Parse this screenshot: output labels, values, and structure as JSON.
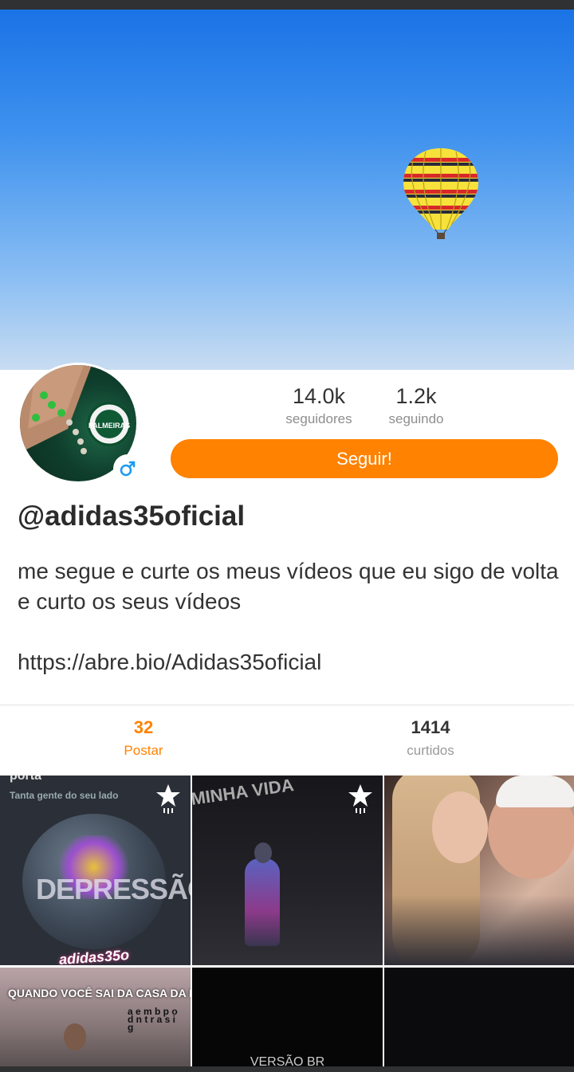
{
  "profile": {
    "username": "@adidas35oficial",
    "gender_icon": "male-icon",
    "avatar_text": "PALMEIRAS"
  },
  "stats": {
    "followers_value": "14.0k",
    "followers_label": "seguidores",
    "following_value": "1.2k",
    "following_label": "seguindo"
  },
  "follow_button": {
    "label": "Seguir!"
  },
  "bio": {
    "line1": "me segue e curte os meus vídeos que eu sigo de volta e curto os seus vídeos",
    "link": "https://abre.bio/Adidas35oficial"
  },
  "tabs": [
    {
      "count": "32",
      "label": "Postar",
      "active": true
    },
    {
      "count": "1414",
      "label": "curtidos",
      "active": false
    }
  ],
  "posts": [
    {
      "overlay_top": "porta",
      "overlay_sub": "Tanta gente do seu lado",
      "overlay_big": "DEPRESSÃO",
      "overlay_bottom": "adidas35o",
      "starred": true
    },
    {
      "overlay_top": "MINHA VIDA",
      "starred": true
    },
    {
      "starred": false
    },
    {
      "overlay_top": "QUANDO VOCÊ SAI DA CASA DA MÃE",
      "starred": false
    },
    {
      "overlay_bottom": "VERSÃO BR",
      "starred": false
    },
    {
      "starred": false
    }
  ],
  "colors": {
    "accent": "#ff8200",
    "text_dark": "#2b2b2b",
    "text_muted": "#8e8e8e"
  }
}
